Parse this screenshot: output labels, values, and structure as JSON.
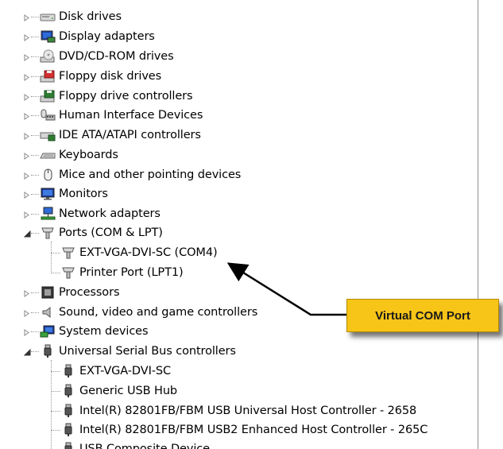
{
  "tree": {
    "disk_drives": "Disk drives",
    "display_adapters": "Display adapters",
    "dvd_drives": "DVD/CD-ROM drives",
    "floppy_disk_drives": "Floppy disk drives",
    "floppy_drive_controllers": "Floppy drive controllers",
    "hid": "Human Interface Devices",
    "ide": "IDE ATA/ATAPI controllers",
    "keyboards": "Keyboards",
    "mice": "Mice and other pointing devices",
    "monitors": "Monitors",
    "network": "Network adapters",
    "ports": "Ports (COM & LPT)",
    "ports_children": [
      "EXT-VGA-DVI-SC (COM4)",
      "Printer Port (LPT1)"
    ],
    "processors": "Processors",
    "sound": "Sound, video and game controllers",
    "system": "System devices",
    "usb": "Universal Serial Bus controllers",
    "usb_children": [
      "EXT-VGA-DVI-SC",
      "Generic USB Hub",
      "Intel(R) 82801FB/FBM USB Universal Host Controller - 2658",
      "Intel(R) 82801FB/FBM USB2 Enhanced Host Controller - 265C",
      "USB Composite Device"
    ]
  },
  "callout": {
    "text": "Virtual COM Port"
  },
  "colors": {
    "callout_fill": "#f7c418",
    "arrow": "#000000"
  },
  "icons": {
    "disk_drives": "disk-drive-icon",
    "display_adapters": "display-adapter-icon",
    "dvd_drives": "dvd-drive-icon",
    "floppy_disk_drives": "floppy-disk-icon",
    "floppy_drive_controllers": "floppy-controller-icon",
    "hid": "hid-icon",
    "ide": "ide-controller-icon",
    "keyboards": "keyboard-icon",
    "mice": "mouse-icon",
    "monitors": "monitor-icon",
    "network": "network-adapter-icon",
    "ports": "port-connector-icon",
    "processors": "processor-icon",
    "sound": "speaker-icon",
    "system": "system-device-icon",
    "usb": "usb-plug-icon"
  }
}
